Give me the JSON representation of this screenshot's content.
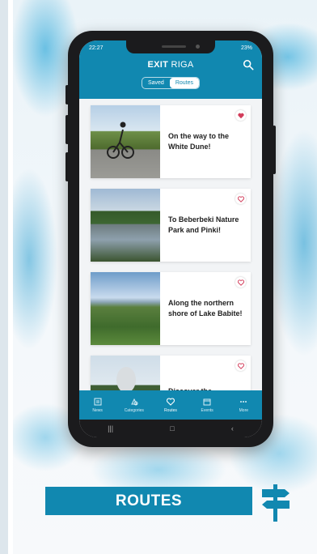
{
  "status_bar": {
    "time": "22:27",
    "battery": "23%"
  },
  "app": {
    "brand_bold": "EXIT",
    "brand_regular": "RIGA",
    "tabs": [
      {
        "label": "Saved",
        "active": false
      },
      {
        "label": "Routes",
        "active": true
      }
    ]
  },
  "routes": [
    {
      "title": "On the way to the White Dune!",
      "favorited": true
    },
    {
      "title": "To Beberbeki Nature Park and Pinki!",
      "favorited": false
    },
    {
      "title": "Along the northern shore of Lake Babite!",
      "favorited": false
    },
    {
      "title": "Discover the",
      "favorited": false
    }
  ],
  "bottom_nav": [
    {
      "label": "News",
      "icon": "newspaper-icon",
      "active": false
    },
    {
      "label": "Categories",
      "icon": "shapes-icon",
      "active": false
    },
    {
      "label": "Routes",
      "icon": "heart-icon",
      "active": true
    },
    {
      "label": "Events",
      "icon": "calendar-icon",
      "active": false
    },
    {
      "label": "More",
      "icon": "more-dots-icon",
      "active": false
    }
  ],
  "banner": {
    "label": "ROUTES",
    "icon": "signpost-icon"
  },
  "colors": {
    "brand": "#1188b0",
    "heart_active": "#d23c5a",
    "heart_outline": "#d23c5a"
  }
}
